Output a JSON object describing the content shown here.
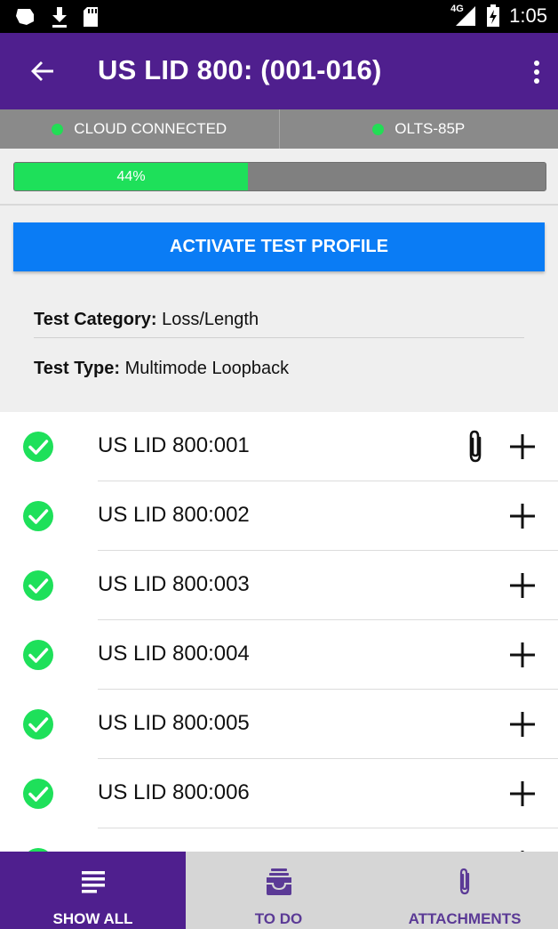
{
  "status_bar": {
    "network": "4G",
    "time": "1:05",
    "icons": [
      "notification-icon",
      "download-icon",
      "sd-card-icon",
      "signal-icon",
      "battery-charging-icon"
    ]
  },
  "app_bar": {
    "title": "US LID 800: (001-016)",
    "icons": [
      "back-arrow-icon",
      "more-vert-icon"
    ]
  },
  "connection": {
    "cloud": "CLOUD CONNECTED",
    "device": "OLTS-85P",
    "status_color": "#22dd55"
  },
  "progress": {
    "percent": 44,
    "label": "44%"
  },
  "activate_button": "ACTIVATE TEST PROFILE",
  "test_info": {
    "category_label": "Test Category:",
    "category_value": "Loss/Length",
    "type_label": "Test Type:",
    "type_value": "Multimode Loopback"
  },
  "items": [
    {
      "name": "US LID 800:001",
      "attachment": true
    },
    {
      "name": "US LID 800:002",
      "attachment": false
    },
    {
      "name": "US LID 800:003",
      "attachment": false
    },
    {
      "name": "US LID 800:004",
      "attachment": false
    },
    {
      "name": "US LID 800:005",
      "attachment": false
    },
    {
      "name": "US LID 800:006",
      "attachment": false
    },
    {
      "name": "",
      "attachment": false
    }
  ],
  "bottom_nav": {
    "show_all": "SHOW ALL",
    "todo": "TO DO",
    "attachments": "ATTACHMENTS"
  },
  "colors": {
    "primary": "#4f1f8e",
    "accent_button": "#0a7cf5",
    "success": "#1ee05a"
  }
}
